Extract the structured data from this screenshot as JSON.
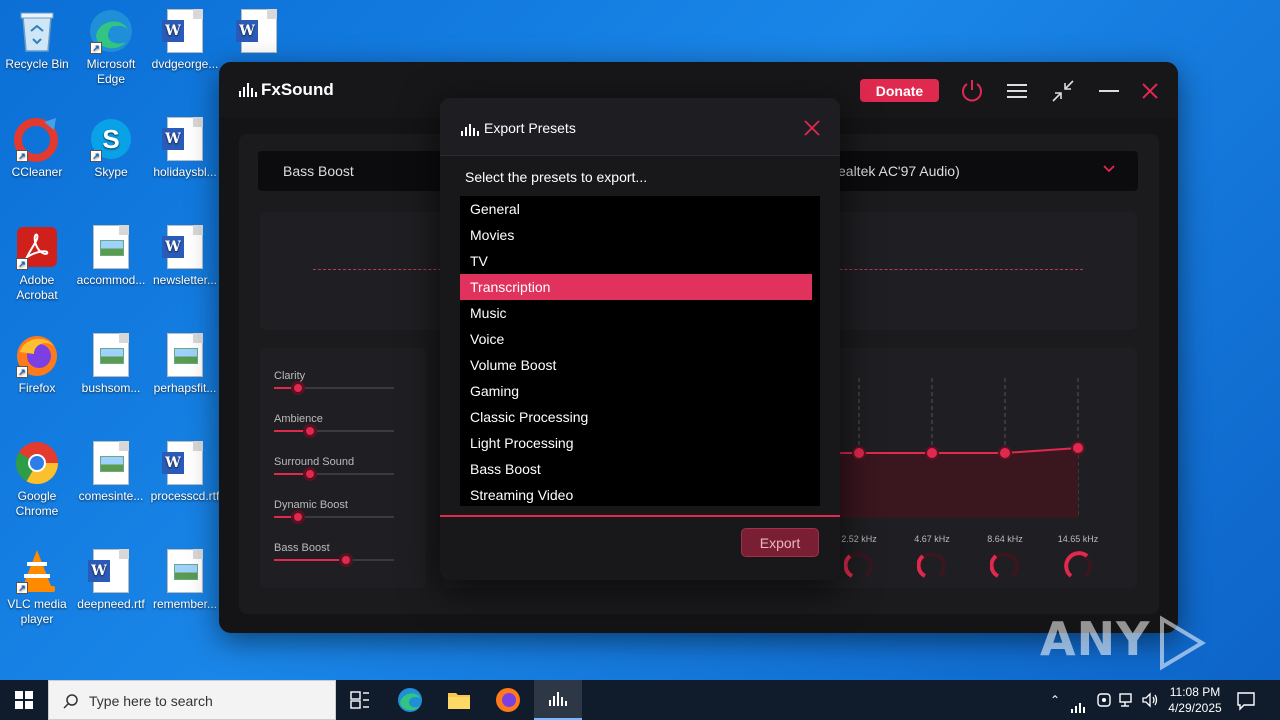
{
  "desktop": {
    "icons": [
      {
        "label": "Recycle Bin"
      },
      {
        "label": "Microsoft Edge"
      },
      {
        "label": "dvdgeorge..."
      },
      {
        "label": ""
      },
      {
        "label": "CCleaner"
      },
      {
        "label": "Skype"
      },
      {
        "label": "holidaysbl..."
      },
      {
        "label": "Adobe Acrobat"
      },
      {
        "label": "accommod..."
      },
      {
        "label": "newsletter..."
      },
      {
        "label": "Firefox"
      },
      {
        "label": "bushsom..."
      },
      {
        "label": "perhapsfit..."
      },
      {
        "label": "Google Chrome"
      },
      {
        "label": "comesinte..."
      },
      {
        "label": "processcd.rtf"
      },
      {
        "label": "VLC media player"
      },
      {
        "label": "deepneed.rtf"
      },
      {
        "label": "remember..."
      }
    ]
  },
  "fxsound": {
    "app_name": "FxSound",
    "donate_label": "Donate",
    "preset_name": "Bass Boost",
    "device_name": "ealtek AC'97 Audio)",
    "effects": [
      {
        "label": "Clarity",
        "level": 0.2
      },
      {
        "label": "Ambience",
        "level": 0.3
      },
      {
        "label": "Surround Sound",
        "level": 0.3
      },
      {
        "label": "Dynamic Boost",
        "level": 0.2
      },
      {
        "label": "Bass Boost",
        "level": 0.6
      }
    ],
    "bands": [
      "2.52 kHz",
      "4.67 kHz",
      "8.64 kHz",
      "14.65 kHz"
    ],
    "accent_color": "#e0294f"
  },
  "dialog": {
    "title": "Export Presets",
    "prompt": "Select the presets to export...",
    "presets": [
      "General",
      "Movies",
      "TV",
      "Transcription",
      "Music",
      "Voice",
      "Volume Boost",
      "Gaming",
      "Classic Processing",
      "Light Processing",
      "Bass Boost",
      "Streaming Video"
    ],
    "selected_preset": "Transcription",
    "export_label": "Export"
  },
  "watermark": {
    "left": "ANY",
    "right": "RUN"
  },
  "taskbar": {
    "search_placeholder": "Type here to search",
    "time": "11:08 PM",
    "date": "4/29/2025"
  }
}
